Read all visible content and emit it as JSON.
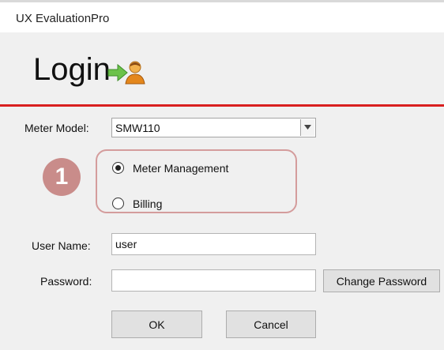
{
  "window": {
    "title": "UX EvaluationPro"
  },
  "header": {
    "heading": "Login",
    "icon": "login-user-icon"
  },
  "accent_color": "#d92020",
  "meter_model": {
    "label": "Meter Model:",
    "selected": "SMW110"
  },
  "annotation": {
    "number": "1",
    "color": "#c98c8a"
  },
  "mode_options": [
    {
      "label": "Meter Management",
      "checked": true
    },
    {
      "label": "Billing",
      "checked": false
    }
  ],
  "username": {
    "label": "User Name:",
    "value": "user"
  },
  "password": {
    "label": "Password:",
    "value": ""
  },
  "buttons": {
    "change_password": "Change Password",
    "ok": "OK",
    "cancel": "Cancel"
  }
}
